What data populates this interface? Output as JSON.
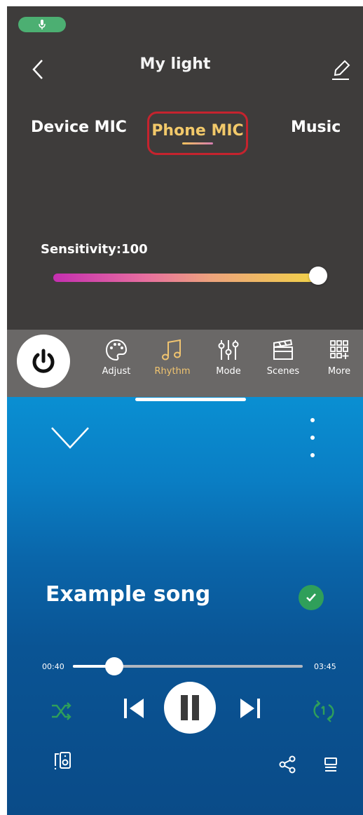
{
  "light_app": {
    "title": "My light",
    "tabs": [
      {
        "label": "Device MIC"
      },
      {
        "label": "Phone MIC"
      },
      {
        "label": "Music"
      }
    ],
    "sensitivity_label": "Sensitivity:100",
    "sensitivity_value": 100,
    "sensitivity_max": 100,
    "nav": [
      {
        "label": "Adjust",
        "icon": "palette-icon"
      },
      {
        "label": "Rhythm",
        "icon": "music-note-icon"
      },
      {
        "label": "Mode",
        "icon": "sliders-icon"
      },
      {
        "label": "Scenes",
        "icon": "clapperboard-icon"
      },
      {
        "label": "More",
        "icon": "grid-plus-icon"
      }
    ],
    "colors": {
      "active_tab": "#f2c96a",
      "highlight_box": "#c5232e",
      "mic_pill": "#4caf72"
    }
  },
  "player": {
    "song_title": "Example song",
    "current_time": "00:40",
    "total_time": "03:45",
    "progress": 0.18,
    "colors": {
      "accent_green": "#2f9f5a"
    }
  }
}
